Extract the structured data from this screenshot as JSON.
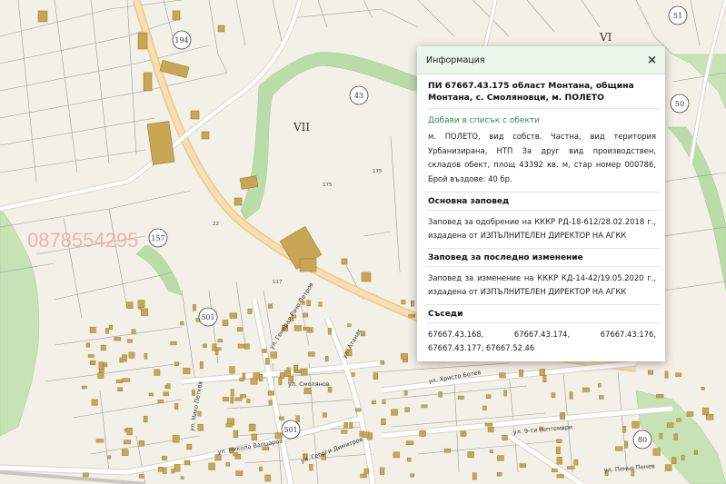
{
  "map": {
    "sector_labels": [
      "VII",
      "VI"
    ],
    "parcel_numbers": [
      "194",
      "43",
      "51",
      "50",
      "157",
      "501",
      "501",
      "80"
    ],
    "small_numbers": [
      "22",
      "175",
      "175",
      "117"
    ],
    "street_labels": [
      "ул. Генерал Рачо Петров",
      "ул. Смолянов",
      "ул. Нико Петков",
      "ул. Атанас",
      "ул. Никола Вапцаров",
      "ул. Христо Ботев",
      "ул. 9-ти септември",
      "ул. Георги Димитров",
      "ул. Пеньо Пенев"
    ],
    "watermark": "0878554295"
  },
  "panel": {
    "title": "Информация",
    "close_symbol": "×",
    "heading": "ПИ 67667.43.175 област Монтана, община Монтана, с. Смоляновци, м. ПОЛЕТО",
    "add_link": "Добави в списък с обекти",
    "description": "м. ПОЛЕТО, вид собств. Частна, вид територия Урбанизирана, НТП За друг вид производствен, складов обект, площ 43392 кв. м, стар номер 000786, Брой въздове: 40 бр.",
    "sections": [
      {
        "title": "Основна заповед",
        "text": "Заповед за одобрение на КККР РД-18-612/28.02.2018 г., издадена от ИЗПЪЛНИТЕЛЕН ДИРЕКТОР НА АГКК"
      },
      {
        "title": "Заповед за последно изменение",
        "text": "Заповед за изменение на КККР КД-14-42/19.05.2020 г., издадена от ИЗПЪЛНИТЕЛЕН ДИРЕКТОР НА АГКК"
      },
      {
        "title": "Съседи",
        "text": "67667.43.168, 67667.43.174, 67667.43.176, 67667.43.177, 67667.52.46"
      }
    ]
  }
}
